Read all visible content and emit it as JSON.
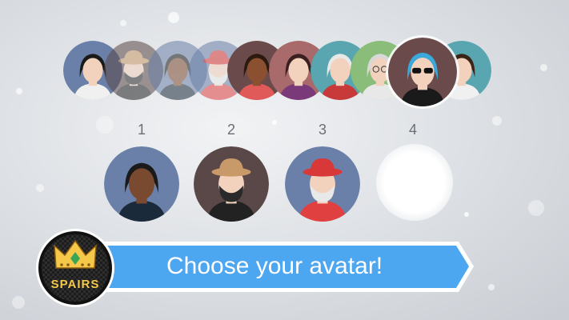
{
  "avatar_carousel": {
    "avatars": [
      {
        "name": "woman-black-hair-avatar",
        "bg": "#6a80a8"
      },
      {
        "name": "man-hat-beard-avatar",
        "bg": "#5a4848"
      },
      {
        "name": "woman-curly-hair-avatar",
        "bg": "#6a80a8"
      },
      {
        "name": "old-man-red-cap-avatar",
        "bg": "#6a80a8"
      },
      {
        "name": "man-dark-skin-avatar",
        "bg": "#6a4a4a"
      },
      {
        "name": "woman-dark-hair-avatar",
        "bg": "#a86a6a"
      },
      {
        "name": "old-woman-white-hair-avatar",
        "bg": "#5aa6b0"
      },
      {
        "name": "old-man-glasses-avatar",
        "bg": "#8abd7a"
      },
      {
        "name": "man-blue-hair-sunglasses-avatar",
        "bg": "#6a4a4a",
        "selected": true
      },
      {
        "name": "woman-brown-hair-avatar",
        "bg": "#5aa6b0"
      }
    ]
  },
  "slots": [
    {
      "number": "1",
      "avatar": "woman-curly-hair-avatar"
    },
    {
      "number": "2",
      "avatar": "man-hat-beard-avatar"
    },
    {
      "number": "3",
      "avatar": "old-man-red-cap-avatar"
    },
    {
      "number": "4",
      "avatar": ""
    }
  ],
  "banner": {
    "text": "Choose your avatar!",
    "color": "#4da6f0"
  },
  "logo": {
    "text": "SPAIRS",
    "accent": "#f5c84a"
  }
}
